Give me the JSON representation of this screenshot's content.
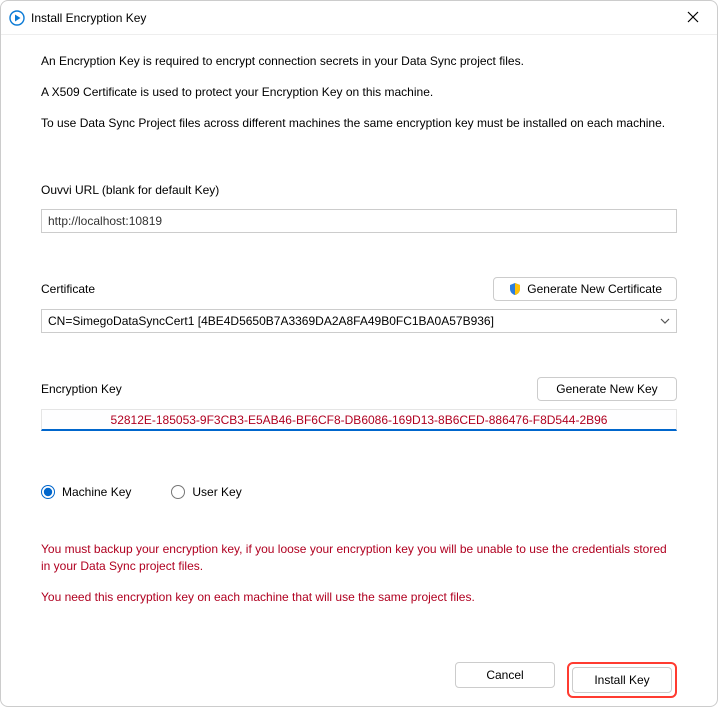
{
  "titlebar": {
    "title": "Install Encryption Key"
  },
  "intro": {
    "line1": "An Encryption Key is required to encrypt connection secrets in your Data Sync project files.",
    "line2": "A X509 Certificate is used to protect your Encryption Key on this machine.",
    "line3": "To use Data Sync Project files across different machines the same encryption key must be installed on each machine."
  },
  "url": {
    "label": "Ouvvi URL (blank for default Key)",
    "value": "http://localhost:10819"
  },
  "certificate": {
    "label": "Certificate",
    "gen_label": "Generate New Certificate",
    "value": "CN=SimegoDataSyncCert1 [4BE4D5650B7A3369DA2A8FA49B0FC1BA0A57B936]"
  },
  "enc_key": {
    "label": "Encryption Key",
    "gen_label": "Generate New Key",
    "value": "52812E-185053-9F3CB3-E5AB46-BF6CF8-DB6086-169D13-8B6CED-886476-F8D544-2B96"
  },
  "radios": {
    "machine": "Machine Key",
    "user": "User Key"
  },
  "warning": {
    "line1": "You must backup your encryption key, if you loose your encryption key you will be unable to use the credentials stored in your Data Sync project files.",
    "line2": "You need this encryption key on each machine that will use the same project files."
  },
  "footer": {
    "cancel": "Cancel",
    "install": "Install Key"
  }
}
